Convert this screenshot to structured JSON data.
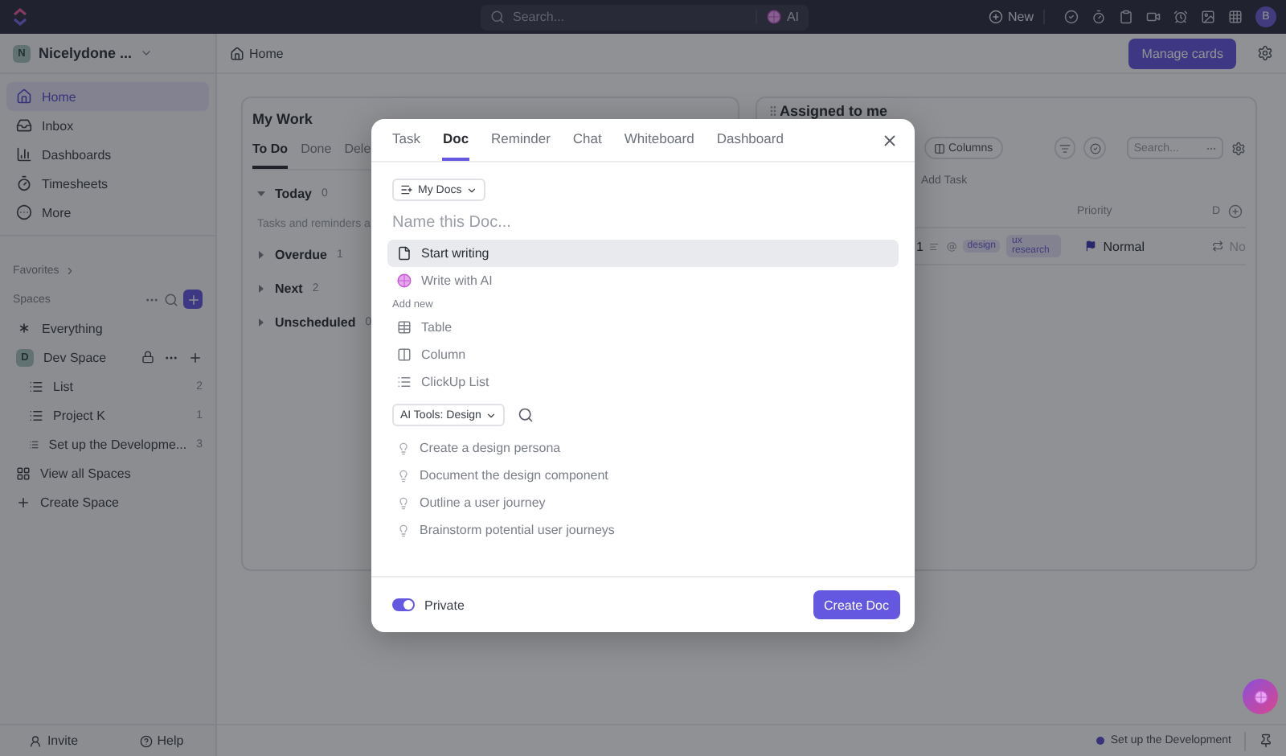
{
  "topbar": {
    "search_placeholder": "Search...",
    "ai_label": "AI",
    "new_label": "New",
    "avatar": "B"
  },
  "sidebar": {
    "workspace": {
      "initial": "N",
      "name": "Nicelydone ..."
    },
    "nav": [
      {
        "label": "Home",
        "selected": true
      },
      {
        "label": "Inbox",
        "selected": false
      },
      {
        "label": "Dashboards",
        "selected": false
      },
      {
        "label": "Timesheets",
        "selected": false
      },
      {
        "label": "More",
        "selected": false
      }
    ],
    "favorites_label": "Favorites",
    "spaces_label": "Spaces",
    "spaces": [
      {
        "kind": "everything",
        "label": "Everything"
      },
      {
        "kind": "space",
        "initial": "D",
        "label": "Dev Space"
      },
      {
        "kind": "list",
        "label": "List",
        "count": "2"
      },
      {
        "kind": "list",
        "label": "Project K",
        "count": "1"
      },
      {
        "kind": "list",
        "label": "Set up the Developme...",
        "count": "3"
      },
      {
        "kind": "view_all",
        "label": "View all Spaces"
      },
      {
        "kind": "create",
        "label": "Create Space"
      }
    ],
    "footer": [
      "Invite",
      "Help"
    ]
  },
  "header": {
    "breadcrumb": "Home",
    "manage_button": "Manage cards"
  },
  "my_work": {
    "title": "My Work",
    "tabs": [
      {
        "label": "To Do",
        "selected": true
      },
      {
        "label": "Done",
        "selected": false
      },
      {
        "label": "Dele",
        "selected": false
      }
    ],
    "groups": [
      {
        "label": "Today",
        "count": "0",
        "note": "Tasks and reminders a"
      },
      {
        "label": "Overdue",
        "count": "1"
      },
      {
        "label": "Next",
        "count": "2"
      },
      {
        "label": "Unscheduled",
        "count": "0"
      }
    ]
  },
  "assigned": {
    "title": "Assigned to me",
    "columns_button": "Columns",
    "search_placeholder": "Search...",
    "add_task": "Add Task",
    "headers": [
      "Priority",
      "D"
    ],
    "row": {
      "column_1": "1",
      "tags": [
        "design",
        "ux research"
      ],
      "priority": "Normal",
      "column_3": "No"
    }
  },
  "modal": {
    "tabs": [
      {
        "label": "Task",
        "selected": false
      },
      {
        "label": "Doc",
        "selected": true
      },
      {
        "label": "Reminder",
        "selected": false
      },
      {
        "label": "Chat",
        "selected": false
      },
      {
        "label": "Whiteboard",
        "selected": false
      },
      {
        "label": "Dashboard",
        "selected": false
      }
    ],
    "location": "My Docs",
    "name_placeholder": "Name this Doc...",
    "options": [
      {
        "label": "Start writing",
        "selected": true
      },
      {
        "label": "Write with AI",
        "selected": false
      }
    ],
    "add_new_label": "Add new",
    "add_new": [
      "Table",
      "Column",
      "ClickUp List"
    ],
    "ai_tools": "AI Tools: Design",
    "suggestions": [
      "Create a design persona",
      "Document the design component",
      "Outline a user journey",
      "Brainstorm potential user journeys"
    ],
    "private": {
      "label": "Private",
      "on": true
    },
    "create_button": "Create Doc"
  },
  "status_bar": {
    "task": "Set up the Development"
  }
}
